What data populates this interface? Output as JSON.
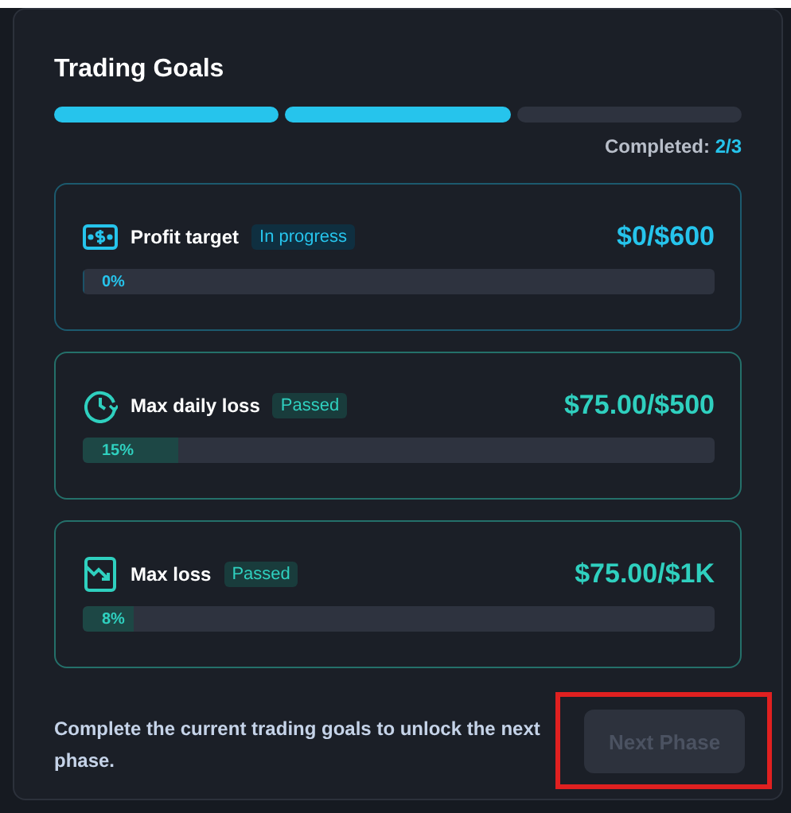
{
  "title": "Trading Goals",
  "segments": [
    {
      "completed": true
    },
    {
      "completed": true
    },
    {
      "completed": false
    }
  ],
  "completed": {
    "label": "Completed:",
    "value": "2/3"
  },
  "goals": [
    {
      "kind": "money",
      "name": "Profit target",
      "status": {
        "kind": "in_progress",
        "label": "In progress"
      },
      "amount": "$0/$600",
      "level": 0,
      "percent": "0%"
    },
    {
      "kind": "clock",
      "name": "Max daily loss",
      "status": {
        "kind": "passed",
        "label": "Passed"
      },
      "amount": "$75.00/$500",
      "level": 0.15,
      "percent": "15%"
    },
    {
      "kind": "trend_down",
      "name": "Max loss",
      "status": {
        "kind": "passed",
        "label": "Passed"
      },
      "amount": "$75.00/$1K",
      "level": 0.08,
      "percent": "8%"
    }
  ],
  "footer": {
    "message": "Complete the current trading goals to unlock the next phase.",
    "button": {
      "label": "Next Phase",
      "disabled": true,
      "highlighted": true
    }
  }
}
